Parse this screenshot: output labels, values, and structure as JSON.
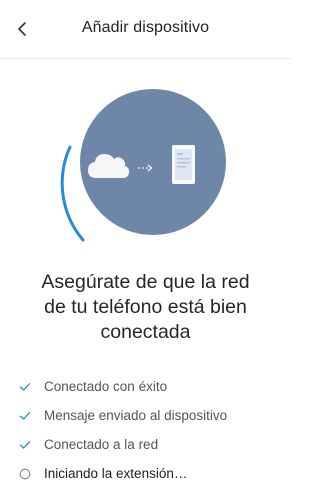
{
  "header": {
    "title": "Añadir dispositivo",
    "back_icon": "chevron-left-icon"
  },
  "illustration": {
    "circle_color": "#6e87a8",
    "arc_color": "#2a8bd2",
    "icons": [
      "cloud-icon",
      "arrow-right-icon",
      "phone-icon"
    ]
  },
  "headline": {
    "line1": "Asegúrate de que la red",
    "line2": "de tu teléfono está bien",
    "line3": "conectada"
  },
  "steps": [
    {
      "label": "Conectado con éxito",
      "status": "done",
      "icon": "check-icon"
    },
    {
      "label": "Mensaje enviado al dispositivo",
      "status": "done",
      "icon": "check-icon"
    },
    {
      "label": "Conectado a la red",
      "status": "done",
      "icon": "check-icon"
    },
    {
      "label": "Iniciando la extensión…",
      "status": "in-progress",
      "icon": "circle-icon"
    }
  ],
  "colors": {
    "accent": "#2a8bd2",
    "check": "#3a8fd6"
  }
}
